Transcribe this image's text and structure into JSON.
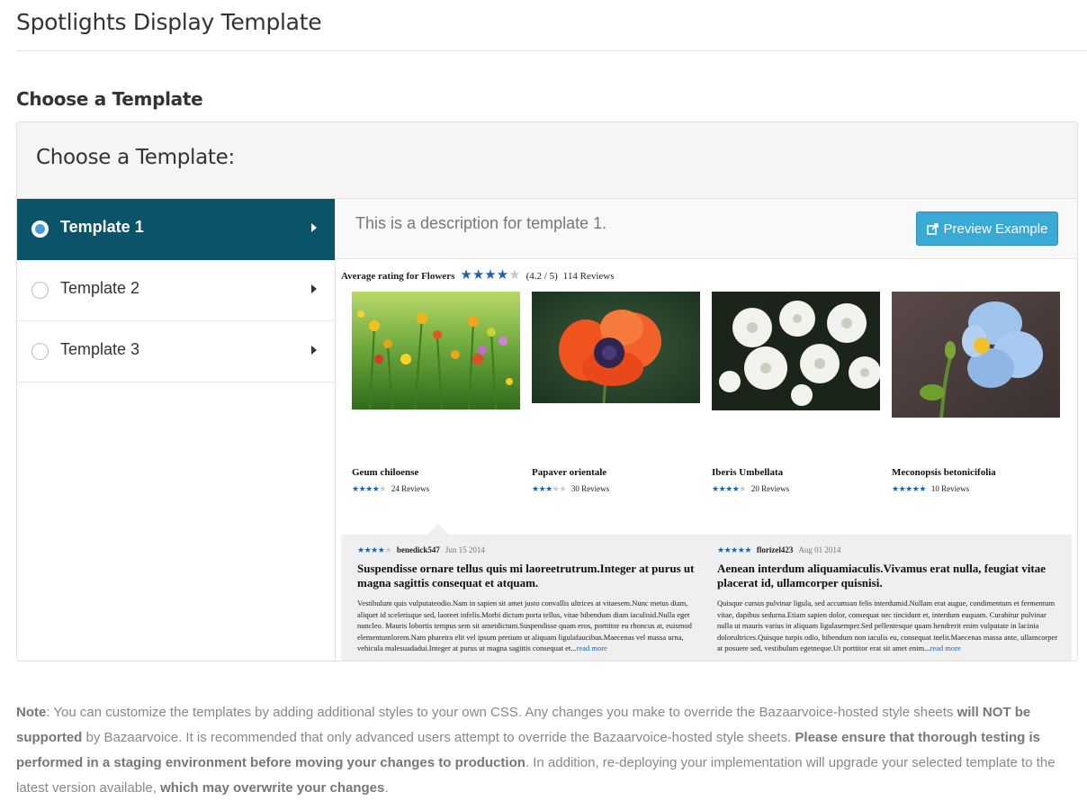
{
  "page": {
    "title": "Spotlights Display Template",
    "section_title": "Choose a Template"
  },
  "panel": {
    "heading": "Choose a Template:",
    "templates": [
      {
        "label": "Template 1",
        "selected": true
      },
      {
        "label": "Template 2",
        "selected": false
      },
      {
        "label": "Template 3",
        "selected": false
      }
    ],
    "description": "This is a description for template 1.",
    "preview_button": "Preview Example"
  },
  "preview": {
    "avg_label": "Average rating for Flowers",
    "avg_rating": 4.2,
    "avg_score_text": "(4.2 / 5)",
    "avg_reviews_text": "114 Reviews",
    "products": [
      {
        "name": "Geum chiloense",
        "rating": 4.5,
        "reviews_text": "24 Reviews",
        "image": "wildflower-meadow-image"
      },
      {
        "name": "Papaver orientale",
        "rating": 3.5,
        "reviews_text": "30 Reviews",
        "image": "red-poppy-image"
      },
      {
        "name": "Iberis Umbellata",
        "rating": 4.5,
        "reviews_text": "20 Reviews",
        "image": "white-flowers-image"
      },
      {
        "name": "Meconopsis betonicifolia",
        "rating": 5,
        "reviews_text": "10 Reviews",
        "image": "blue-poppy-image"
      }
    ],
    "reviews": [
      {
        "rating": 4,
        "user": "benedick547",
        "date": "Jun 15 2014",
        "title": "Suspendisse ornare tellus quis mi laoreetrutrum.Integer at purus ut magna sagittis consequat et atquam.",
        "body": "Vestibulum quis vulputateodio.Nam in sapien sit amet justo convallis ultrices at vitaesem.Nunc metus diam, aliquet id scelerisque sed, laoreet infelis.Morbi dictum porta tellus, vitae bibendum diam iaculisid.Nulla eget nuncleo. Mauris lobortis tempus sem sit ametdictum.Suspendisse quam eros, porttitor eu rhoncus at, euismod elementumlorem.Nam pharetra elit vel ipsum pretium ut aliquam ligulafaucibus.Maecenas vel massa urna, vehicula malesuadadui.Integer at purus ut magna sagittis consequat et...",
        "more": "read more"
      },
      {
        "rating": 5,
        "user": "florizel423",
        "date": "Aug 01 2014",
        "title": "Aenean interdum aliquamiaculis.Vivamus erat nulla, feugiat vitae placerat id, ullamcorper quisnisi.",
        "body": "Quisque cursus pulvinar ligula, sed accumsan felis interdumid.Nullam erat augue, condimentum et fermentum vitae, dapibus sedurna.Etiam sapien dolor, consequat nec tincidunt et, interdum euquam. Curabitur pulvinar nulla ut mauris varius in aliquam ligulasemper.Sed pellentesque quam hendrerit enim vulputate in lacinia dolorultrices.Quisque turpis odio, bibendum non iaculis eu, consequat inelit.Maecenas massa ante, ullamcorper at posuere sed, vestibulum egetneque.Ut porttitor erat sit amet enim...",
        "more": "read more"
      }
    ]
  },
  "note": {
    "lead": "Note",
    "t1": ": You can customize the templates by adding additional styles to your own CSS. Any changes you make to override the Bazaarvoice-hosted style sheets ",
    "b1": "will NOT be supported",
    "t2": " by Bazaarvoice. It is recommended that only advanced users attempt to override the Bazaarvoice-hosted style sheets. ",
    "b2": "Please ensure that thorough testing is performed in a staging environment before moving your changes to production",
    "t3": ". In addition, re-deploying your implementation will upgrade your selected template to the latest version available, ",
    "b3": "which may overwrite your changes",
    "t4": "."
  },
  "colors": {
    "selected_bg": "#0b5369",
    "button_bg": "#39a9d6",
    "star_on": "#1d63ac",
    "star_off": "#c8c8c8"
  }
}
